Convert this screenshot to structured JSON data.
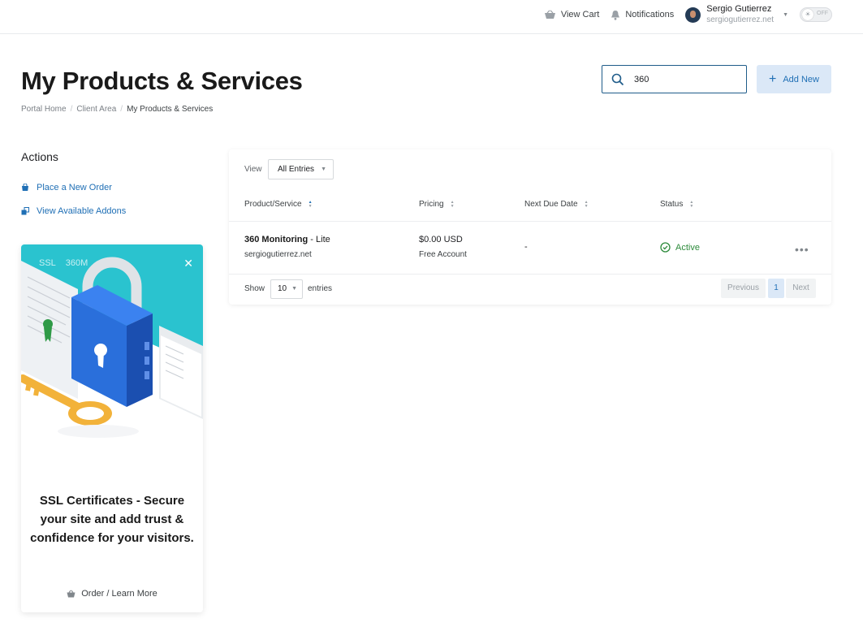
{
  "topnav": {
    "cart_label": "View Cart",
    "notifications_label": "Notifications",
    "user_name": "Sergio Gutierrez",
    "user_domain": "sergiogutierrez.net",
    "theme_toggle_label": "OFF"
  },
  "header": {
    "title": "My Products & Services",
    "breadcrumb": [
      "Portal Home",
      "Client Area",
      "My Products & Services"
    ],
    "search_value": "360",
    "add_new_label": "Add New"
  },
  "sidebar": {
    "actions_title": "Actions",
    "links": [
      {
        "label": "Place a New Order",
        "icon": "cart-icon"
      },
      {
        "label": "View Available Addons",
        "icon": "addons-icon"
      }
    ],
    "promo": {
      "tags": [
        "SSL",
        "360M"
      ],
      "headline": "SSL Certificates - Secure your site and add trust & confidence for your visitors.",
      "cta": "Order / Learn More",
      "colors": {
        "art_bg": "#29c4d1",
        "lock": "#2a6fdb",
        "key": "#f6b73c"
      }
    }
  },
  "table": {
    "view_label": "View",
    "view_value": "All Entries",
    "columns": [
      "Product/Service",
      "Pricing",
      "Next Due Date",
      "Status"
    ],
    "rows": [
      {
        "product_name": "360 Monitoring",
        "product_plan": " - Lite",
        "domain": "sergiogutierrez.net",
        "price": "$0.00 USD",
        "billing": "Free Account",
        "next_due": "-",
        "status": "Active"
      }
    ],
    "show_label": "Show",
    "page_length": "10",
    "entries_label": "entries",
    "pagination": {
      "previous": "Previous",
      "current": "1",
      "next": "Next"
    }
  },
  "colors": {
    "accent": "#1f6fb5",
    "active_status": "#2e8b3c",
    "search_border": "#1f5c8a"
  }
}
